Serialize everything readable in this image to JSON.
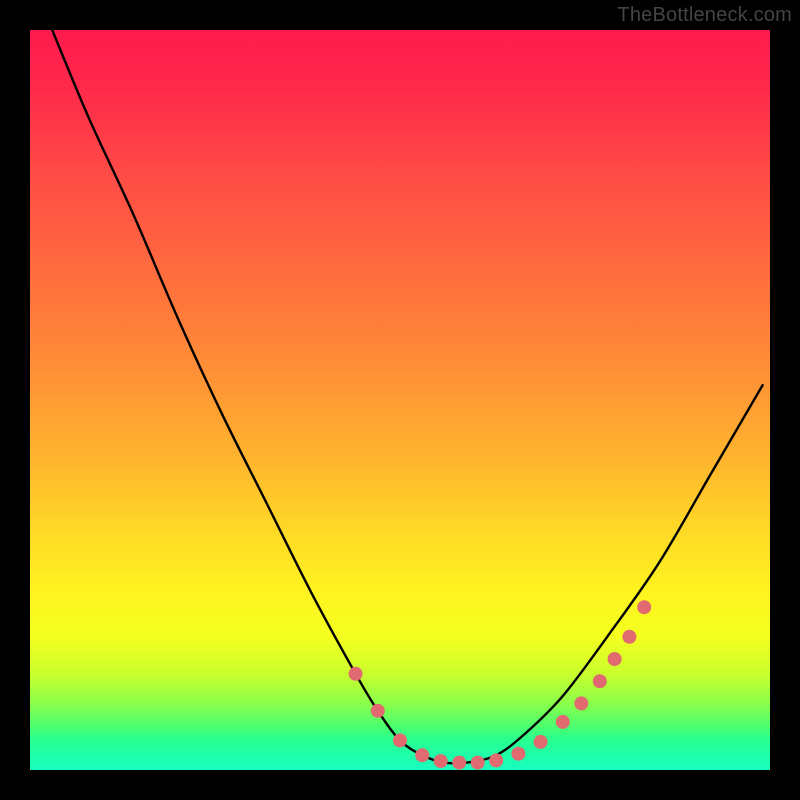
{
  "watermark": "TheBottleneck.com",
  "colors": {
    "background": "#000000",
    "curve": "#000000",
    "marker_fill": "#e06a6f",
    "marker_stroke": "#c94f55"
  },
  "chart_data": {
    "type": "line",
    "title": "",
    "xlabel": "",
    "ylabel": "",
    "xlim": [
      0,
      100
    ],
    "ylim": [
      0,
      100
    ],
    "grid": false,
    "series": [
      {
        "name": "bottleneck-curve",
        "x": [
          3,
          8,
          14,
          20,
          26,
          32,
          38,
          44,
          47,
          50,
          53,
          56,
          59,
          63,
          67,
          72,
          78,
          85,
          92,
          99
        ],
        "values": [
          100,
          88,
          75,
          61,
          48,
          36,
          24,
          13,
          8,
          4,
          2,
          1,
          1,
          2,
          5,
          10,
          18,
          28,
          40,
          52
        ]
      }
    ],
    "markers": {
      "name": "highlight-points",
      "x": [
        44,
        47,
        50,
        53,
        55.5,
        58,
        60.5,
        63,
        66,
        69,
        72,
        74.5,
        77,
        79,
        81,
        83
      ],
      "values": [
        13,
        8,
        4,
        2,
        1.2,
        1,
        1,
        1.3,
        2.2,
        3.8,
        6.5,
        9,
        12,
        15,
        18,
        22
      ]
    }
  }
}
